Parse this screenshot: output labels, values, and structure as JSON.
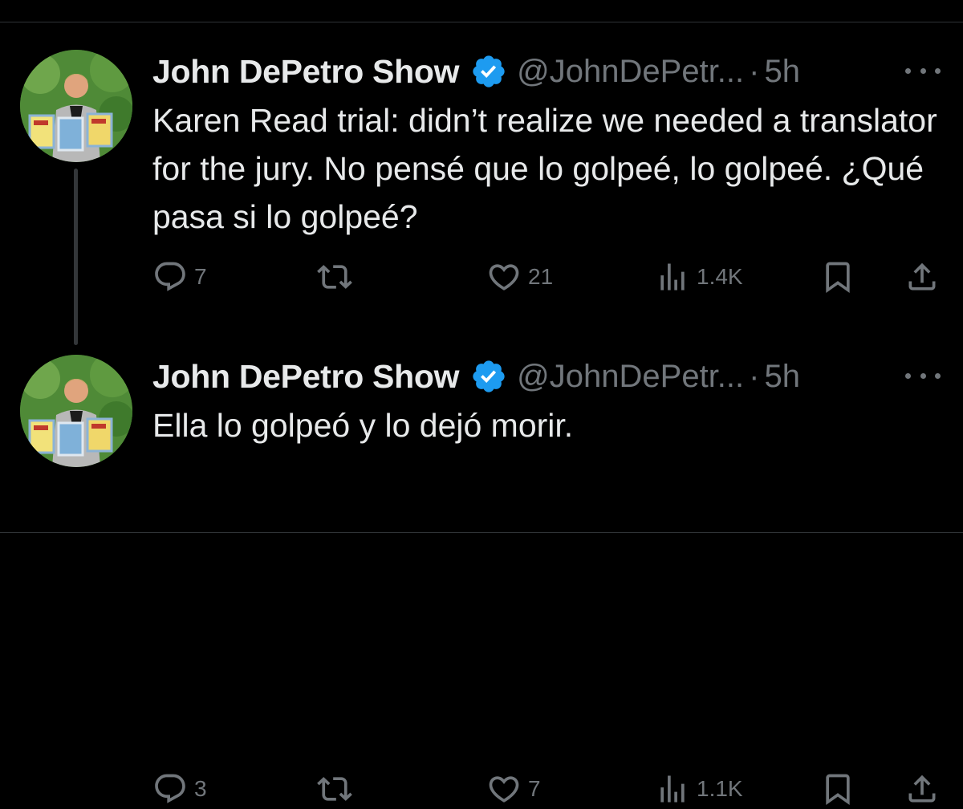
{
  "tweets": [
    {
      "name": "John DePetro Show",
      "handle": "@JohnDePetr...",
      "separator": "·",
      "time": "5h",
      "text": "Karen Read trial: didn’t realize we needed a translator for the jury. No pensé que lo golpeé, lo golpeé. ¿Qué pasa si lo golpeé?",
      "replies": "7",
      "likes": "21",
      "views": "1.4K"
    },
    {
      "name": "John DePetro Show",
      "handle": "@JohnDePetr...",
      "separator": "·",
      "time": "5h",
      "text": "Ella lo golpeó y lo dejó morir.",
      "replies": "3",
      "likes": "7",
      "views": "1.1K"
    }
  ],
  "icons": {
    "avatar": "avatar-photo",
    "verified": "verified-badge-icon",
    "more": "more-options-icon",
    "reply": "reply-icon",
    "retweet": "retweet-icon",
    "like": "heart-icon",
    "views": "views-chart-icon",
    "bookmark": "bookmark-icon",
    "share": "share-icon"
  },
  "colors": {
    "background": "#000000",
    "text": "#e7e9ea",
    "secondary": "#71767b",
    "verified": "#1d9bf0",
    "thread_line": "#333639"
  }
}
